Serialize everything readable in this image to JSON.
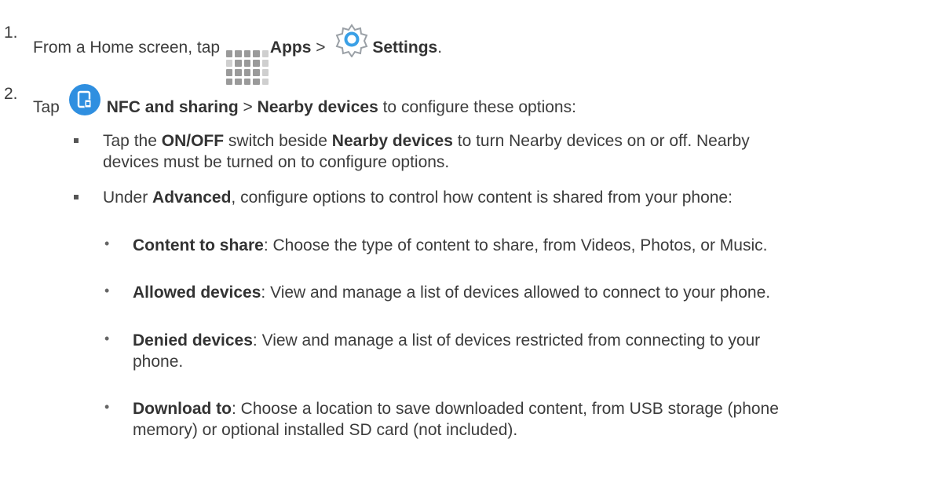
{
  "step1": {
    "number": "1.",
    "text_before": "From a Home screen, tap ",
    "apps_label": "Apps",
    "separator": " > ",
    "settings_label": "Settings",
    "end": "."
  },
  "step2": {
    "number": "2.",
    "text_before": "Tap ",
    "nfc_label": "NFC and sharing",
    "separator": " > ",
    "nearby_label": "Nearby devices",
    "text_after": " to configure these options:"
  },
  "bullets": [
    {
      "prefix": "Tap the ",
      "bold1": "ON/OFF",
      "mid": " switch beside ",
      "bold2": "Nearby devices",
      "suffix_line1": " to turn Nearby devices on or off. Nearby",
      "line2": "devices must be turned on to configure options."
    },
    {
      "prefix": "Under ",
      "bold1": "Advanced",
      "suffix": ", configure options to control how content is shared from your phone:"
    }
  ],
  "sub_items": [
    {
      "term": "Content to share",
      "line1": ": Choose the type of content to share, from Videos, Photos, or Music.",
      "line2": ""
    },
    {
      "term": "Allowed devices",
      "line1": ": View and manage a list of devices allowed to connect to your phone.",
      "line2": ""
    },
    {
      "term": "Denied devices",
      "line1": ": View and manage a list of devices restricted from connecting to your",
      "line2": "phone."
    },
    {
      "term": "Download to",
      "line1": ": Choose a location to save downloaded content, from USB storage (phone",
      "line2": "memory) or optional installed SD card (not included)."
    }
  ],
  "colors": {
    "text": "#3c3c3c",
    "nfc_icon": "#2f8fe0",
    "settings_icon": "#3aa0e6"
  },
  "icons": [
    "apps-grid-icon",
    "settings-gear-icon",
    "nfc-sharing-icon"
  ]
}
